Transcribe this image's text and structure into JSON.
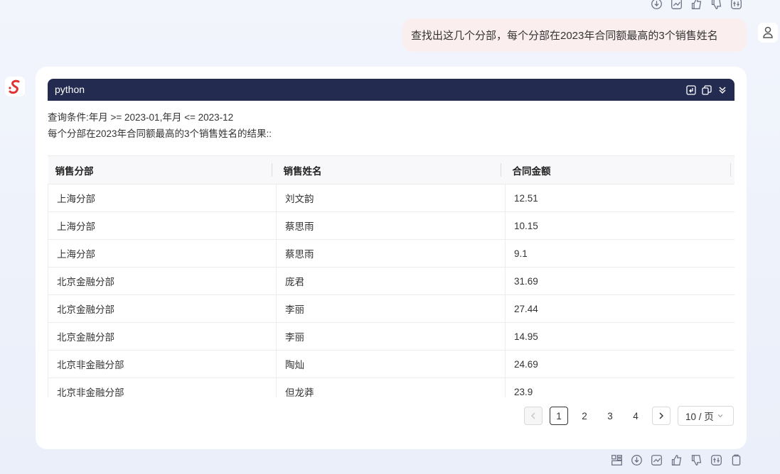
{
  "user_message": "查找出这几个分部，每个分部在2023年合同额最高的3个销售姓名",
  "code_block": {
    "language": "python"
  },
  "query": {
    "condition": "查询条件:年月 >= 2023-01,年月 <= 2023-12",
    "result_title": "每个分部在2023年合同额最高的3个销售姓名的结果::"
  },
  "table": {
    "columns": [
      "销售分部",
      "销售姓名",
      "合同金额"
    ],
    "rows": [
      [
        "上海分部",
        "刘文韵",
        "12.51"
      ],
      [
        "上海分部",
        "蔡思雨",
        "10.15"
      ],
      [
        "上海分部",
        "蔡思雨",
        "9.1"
      ],
      [
        "北京金融分部",
        "庞君",
        "31.69"
      ],
      [
        "北京金融分部",
        "李丽",
        "27.44"
      ],
      [
        "北京金融分部",
        "李丽",
        "14.95"
      ],
      [
        "北京非金融分部",
        "陶灿",
        "24.69"
      ],
      [
        "北京非金融分部",
        "但龙莽",
        "23.9"
      ]
    ]
  },
  "pagination": {
    "pages": [
      "1",
      "2",
      "3",
      "4"
    ],
    "current": "1",
    "page_size": "10 / 页"
  },
  "icons": {
    "top_actions": [
      "download-icon",
      "chart-icon",
      "thumbs-up-icon",
      "thumbs-down-icon",
      "settings-icon"
    ],
    "bottom_actions": [
      "layout-icon",
      "download-icon",
      "chart-icon",
      "thumbs-up-icon",
      "thumbs-down-icon",
      "settings-icon",
      "clipboard-icon"
    ]
  },
  "colors": {
    "code_header": "#232c50",
    "user_bubble": "#fbeeee",
    "brand": "#e03232"
  }
}
